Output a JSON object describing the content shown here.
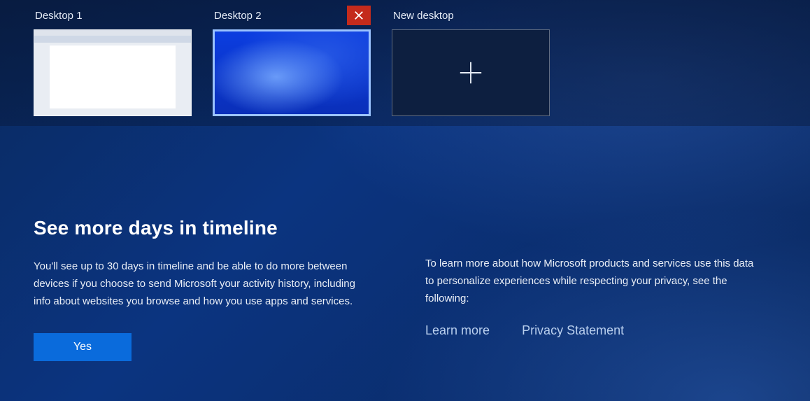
{
  "desktops": {
    "items": [
      {
        "label": "Desktop 1"
      },
      {
        "label": "Desktop 2"
      },
      {
        "label": "New desktop"
      }
    ],
    "close_icon": "close-icon",
    "add_icon": "plus-icon"
  },
  "promo": {
    "title": "See more days in timeline",
    "left_text": "You'll see up to 30 days in timeline and be able to do more between devices if you choose to send Microsoft your activity history, including info about websites you browse and how you use apps and services.",
    "right_text": "To learn more about how Microsoft products and services use this data to personalize experiences while respecting your privacy, see the following:",
    "learn_more": "Learn more",
    "privacy": "Privacy Statement",
    "yes": "Yes"
  }
}
